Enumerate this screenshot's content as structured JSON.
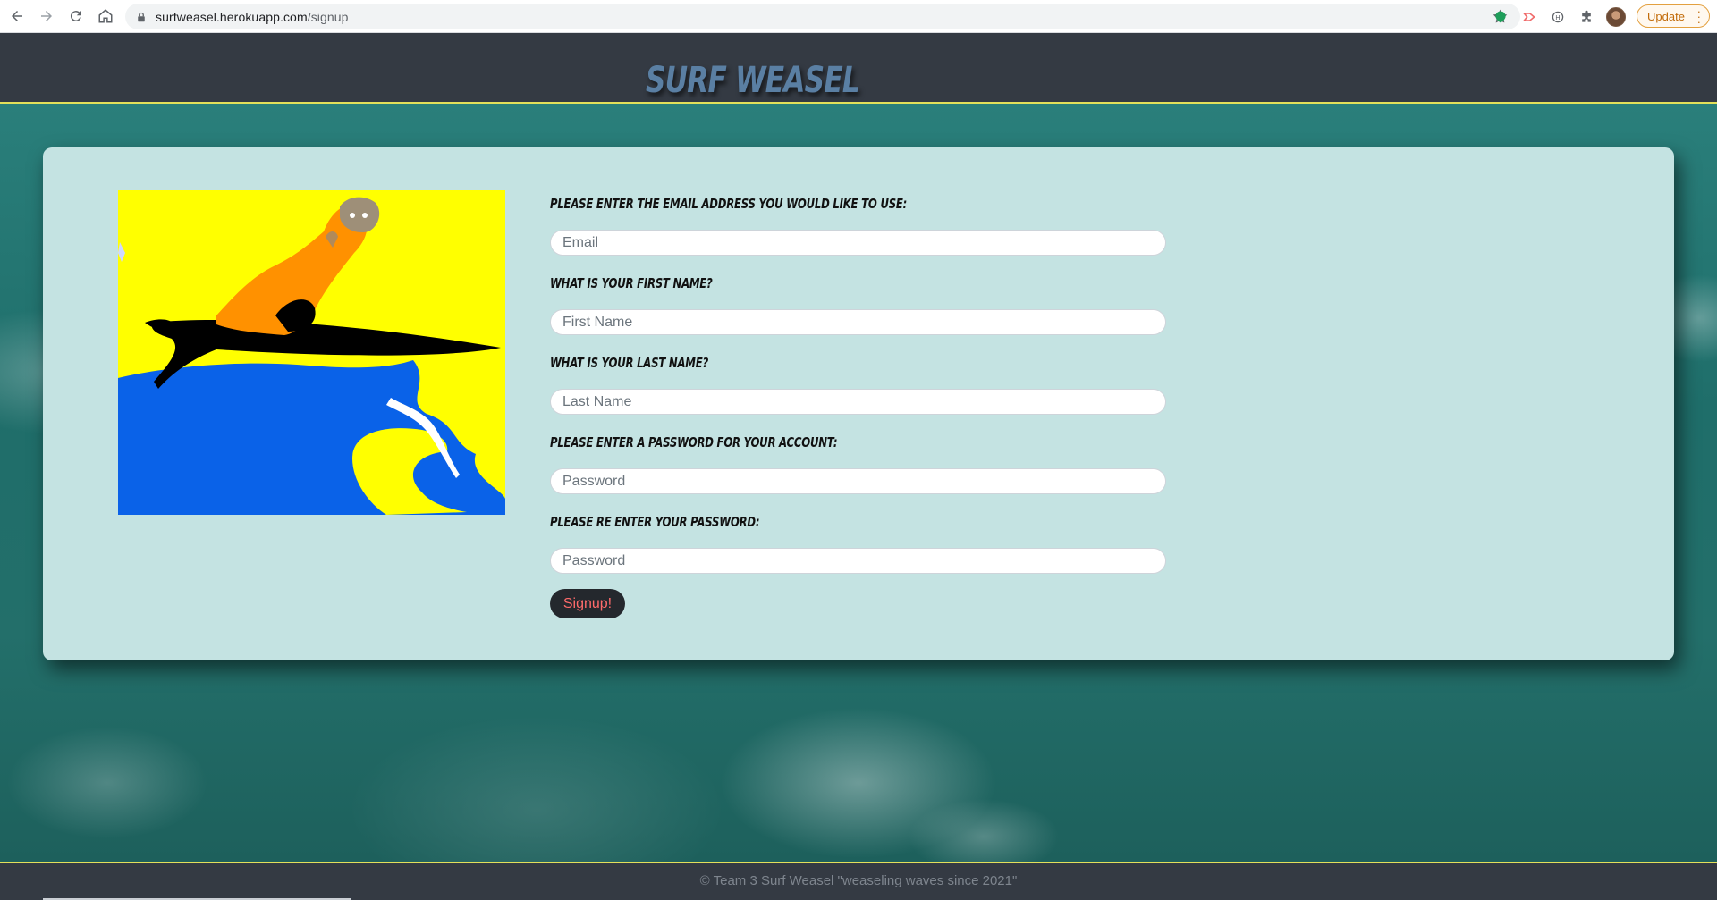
{
  "browser": {
    "url_host": "surfweasel.herokuapp.com",
    "url_path": "/signup",
    "update_label": "Update"
  },
  "header": {
    "title": "Surf Weasel"
  },
  "signup_form": {
    "email": {
      "label": "Please enter the email address you would like to use:",
      "placeholder": "Email"
    },
    "first_name": {
      "label": "What is your first name?",
      "placeholder": "First Name"
    },
    "last_name": {
      "label": "What is your last name?",
      "placeholder": "Last Name"
    },
    "password": {
      "label": "Please enter a password for your account:",
      "placeholder": "Password"
    },
    "password_confirm": {
      "label": "Please re enter your password:",
      "placeholder": "Password"
    },
    "submit_label": "Signup!"
  },
  "footer": {
    "text": "© Team 3 Surf Weasel \"weaseling waves since 2021\""
  },
  "colors": {
    "header_bg": "#343a43",
    "accent_line": "#e3e05a",
    "card_bg": "#c4e3e2",
    "button_bg": "#24282d",
    "button_text": "#ff6b6b",
    "title": "#5a7fa3"
  },
  "icons": [
    "back-arrow-icon",
    "forward-arrow-icon",
    "reload-icon",
    "home-icon",
    "lock-icon",
    "star-icon",
    "extension-green-icon",
    "extension-red-icon",
    "extension-circle-icon",
    "puzzle-icon",
    "profile-avatar",
    "kebab-menu-icon"
  ]
}
